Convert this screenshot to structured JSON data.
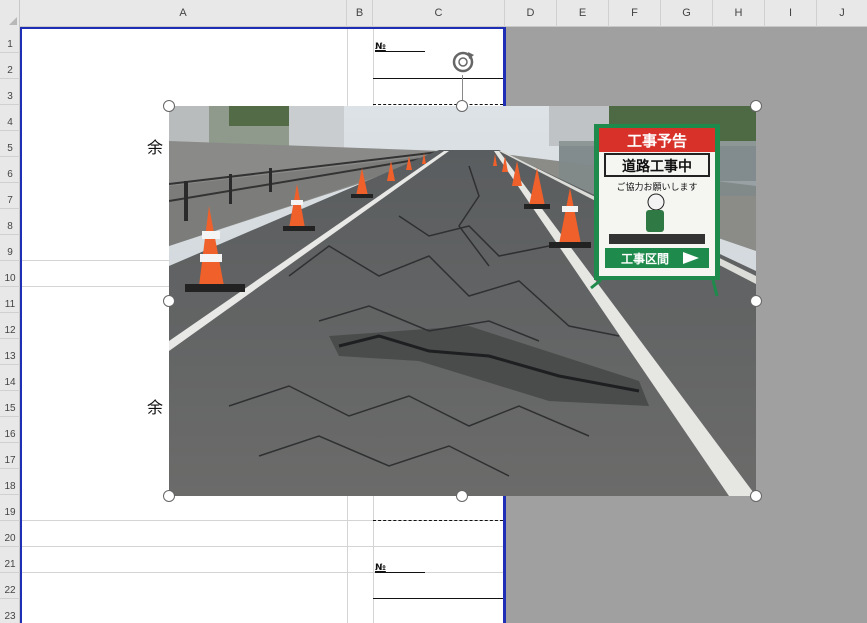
{
  "spreadsheet": {
    "columns": [
      "A",
      "B",
      "C",
      "D",
      "E",
      "F",
      "G",
      "H",
      "I",
      "J"
    ],
    "rows": [
      "1",
      "2",
      "3",
      "4",
      "5",
      "6",
      "7",
      "8",
      "9",
      "10",
      "11",
      "12",
      "13",
      "14",
      "15",
      "16",
      "17",
      "18",
      "19",
      "20",
      "21",
      "22",
      "23"
    ]
  },
  "cells": {
    "no_label_top": "№",
    "no_label_bottom": "№",
    "remaining_1": "余",
    "remaining_2": "余"
  },
  "image": {
    "sign": {
      "header": "工事予告",
      "title": "道路工事中",
      "message": "ご協力お願いします",
      "footer": "工事区間"
    }
  },
  "colors": {
    "selection_blue": "#1f2fb5",
    "sign_red": "#d8312a",
    "sign_green": "#1e8a4b"
  }
}
